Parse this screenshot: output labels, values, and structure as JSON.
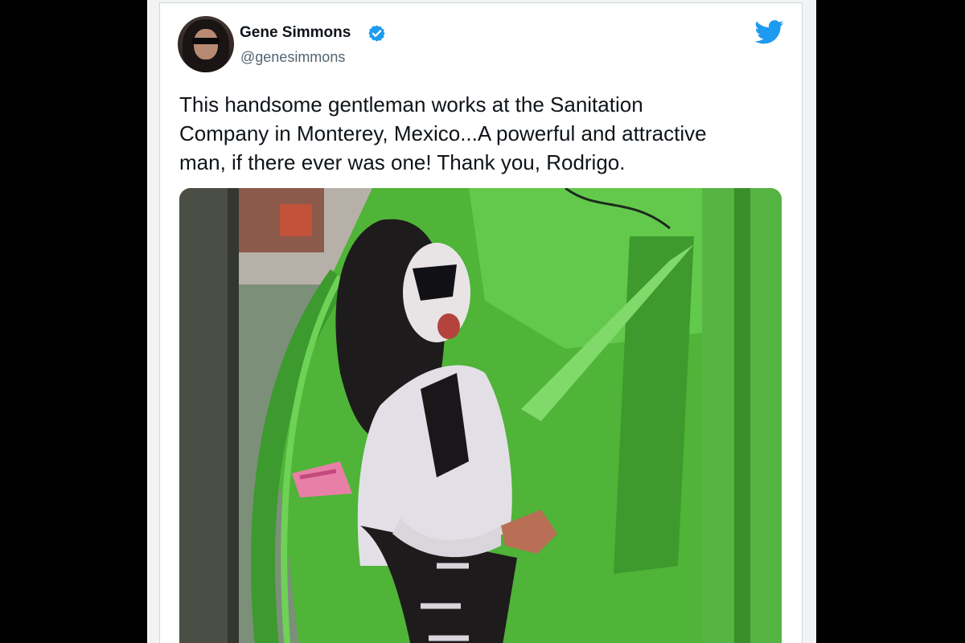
{
  "tweet": {
    "author_name": "Gene Simmons",
    "author_handle": "@genesimmons",
    "verified": true,
    "text": "This handsome gentleman works at the Sanitation\nCompany in Monterey, Mexico...A powerful and attractive\nman, if there ever was one! Thank you, Rodrigo."
  },
  "icons": {
    "verified": "verified-badge-icon",
    "brand": "twitter-bird-icon",
    "avatar": "avatar-photo"
  },
  "colors": {
    "brand_blue": "#1d9bf0",
    "text_primary": "#0f1419",
    "text_secondary": "#536471",
    "truck_green": "#5fbf48"
  }
}
